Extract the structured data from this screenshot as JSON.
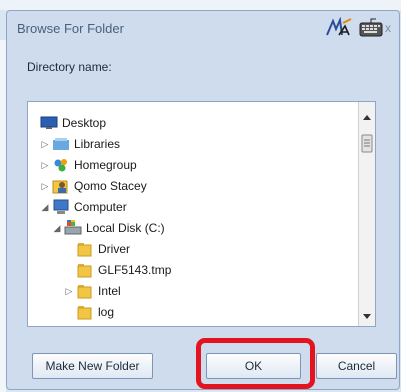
{
  "window": {
    "title": "Browse For Folder",
    "close_glyph": "x"
  },
  "label": {
    "directory": "Directory name:"
  },
  "tree": {
    "items": [
      {
        "label": "Desktop",
        "icon": "desktop-icon",
        "expander": ""
      },
      {
        "label": "Libraries",
        "icon": "libraries-icon",
        "expander": "▷"
      },
      {
        "label": "Homegroup",
        "icon": "homegroup-icon",
        "expander": "▷"
      },
      {
        "label": "Qomo Stacey",
        "icon": "user-folder-icon",
        "expander": "▷"
      },
      {
        "label": "Computer",
        "icon": "computer-icon",
        "expander": "◢"
      },
      {
        "label": "Local Disk (C:)",
        "icon": "local-disk-icon",
        "expander": "◢"
      },
      {
        "label": "Driver",
        "icon": "folder-icon",
        "expander": ""
      },
      {
        "label": "GLF5143.tmp",
        "icon": "folder-icon",
        "expander": ""
      },
      {
        "label": "Intel",
        "icon": "folder-icon",
        "expander": "▷"
      },
      {
        "label": "log",
        "icon": "folder-icon",
        "expander": ""
      }
    ]
  },
  "buttons": {
    "new_folder": "Make New Folder",
    "ok": "OK",
    "cancel": "Cancel"
  },
  "colors": {
    "highlight": "#e3141f",
    "folder": "#f2c543"
  }
}
